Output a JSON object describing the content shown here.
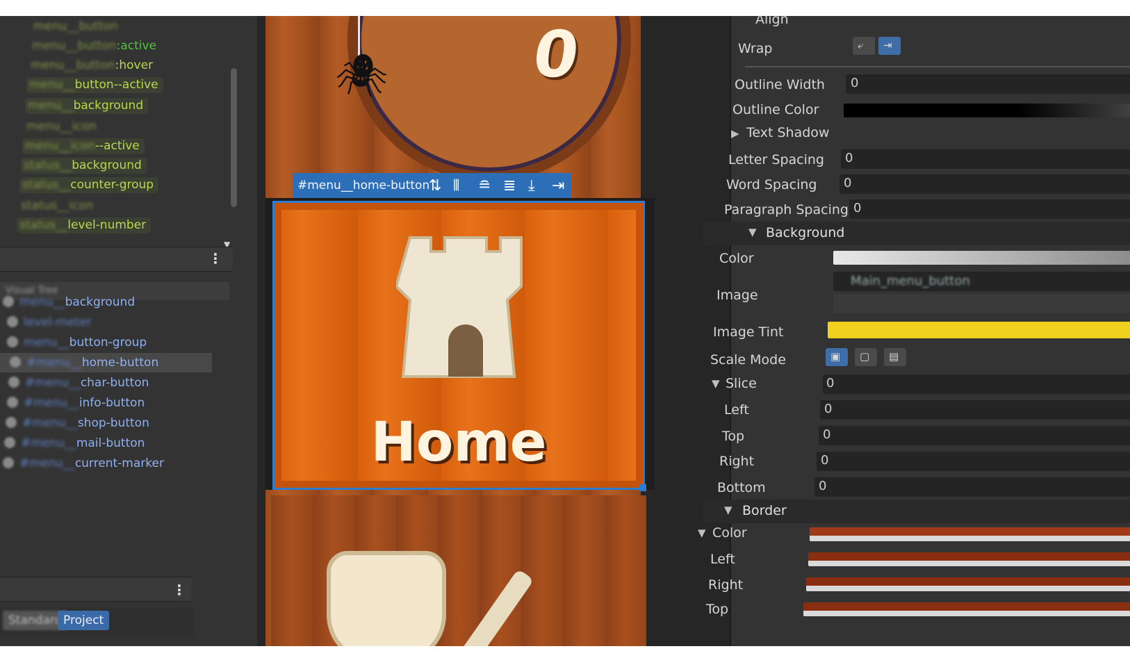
{
  "selectors": {
    "items": [
      {
        "blur": "menu__button",
        "clear": "",
        "kind": "plain"
      },
      {
        "blur": "menu__button",
        "clear": ":active",
        "kind": "active"
      },
      {
        "blur": "menu__button",
        "clear": ":hover",
        "kind": "hover"
      },
      {
        "blur": "menu__",
        "clear": "button--active",
        "kind": "boxed"
      },
      {
        "blur": "menu__",
        "clear": "background",
        "kind": "boxed"
      },
      {
        "blur": "menu__icon",
        "clear": "",
        "kind": "plain"
      },
      {
        "blur": "menu__icon",
        "clear": "--active",
        "kind": "boxed"
      },
      {
        "blur": "status__",
        "clear": "background",
        "kind": "boxed"
      },
      {
        "blur": "status__",
        "clear": "counter-group",
        "kind": "boxed"
      },
      {
        "blur": "status__icon",
        "clear": "",
        "kind": "plain"
      },
      {
        "blur": "status__",
        "clear": "level-number",
        "kind": "boxed"
      }
    ]
  },
  "hierarchy": {
    "items": [
      {
        "blur": "menu__",
        "clear": "background"
      },
      {
        "blur": "level-meter",
        "clear": ""
      },
      {
        "blur": "menu__",
        "clear": "button-group"
      },
      {
        "blur": "#menu__",
        "clear": "home-button",
        "selected": true
      },
      {
        "blur": "#menu__",
        "clear": "char-button"
      },
      {
        "blur": "#menu__",
        "clear": "info-button"
      },
      {
        "blur": "#menu__",
        "clear": "shop-button"
      },
      {
        "blur": "#menu__",
        "clear": "mail-button"
      },
      {
        "blur": "#menu__",
        "clear": "current-marker"
      }
    ]
  },
  "tabs": {
    "standard": "Standard",
    "project": "Project"
  },
  "canvas": {
    "top_counter": "0",
    "selected_name": "#menu__home-button",
    "button_label": "Home"
  },
  "inspector": {
    "align_label": "Align",
    "wrap_label": "Wrap",
    "outline_width_label": "Outline Width",
    "outline_width_value": "0",
    "outline_color_label": "Outline Color",
    "text_shadow_label": "Text Shadow",
    "letter_spacing_label": "Letter Spacing",
    "letter_spacing_value": "0",
    "word_spacing_label": "Word Spacing",
    "word_spacing_value": "0",
    "paragraph_spacing_label": "Paragraph Spacing",
    "paragraph_spacing_value": "0",
    "background_section": "Background",
    "color_label": "Color",
    "image_label": "Image",
    "image_value": "Main_menu_button",
    "image_tint_label": "Image Tint",
    "scale_mode_label": "Scale Mode",
    "slice_label": "Slice",
    "slice_value": "0",
    "left_label": "Left",
    "left_value": "0",
    "top_label": "Top",
    "top_value": "0",
    "right_label": "Right",
    "right_value": "0",
    "bottom_label": "Bottom",
    "bottom_value": "0",
    "border_section": "Border",
    "border_color_label": "Color",
    "border_left_label": "Left",
    "border_right_label": "Right",
    "border_top_label": "Top"
  },
  "colors": {
    "accent": "#2c6fb8",
    "button_orange": "#e8721a",
    "tint_yellow": "#f0d21e",
    "border_color": "#a23a1a"
  }
}
